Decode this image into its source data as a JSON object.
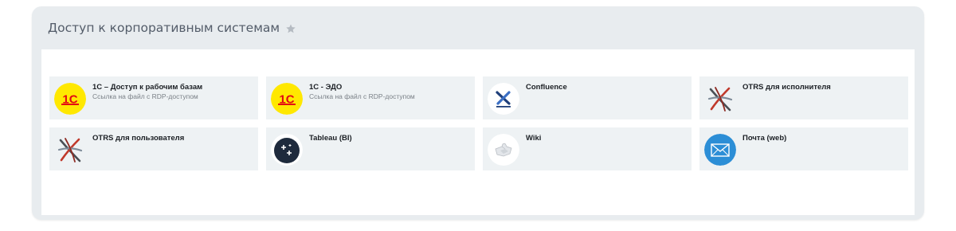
{
  "section": {
    "title": "Доступ к корпоративным системам",
    "star_icon": "star-icon"
  },
  "colors": {
    "panel_bg": "#e8ecef",
    "tile_bg": "#eef2f4",
    "onec_yellow": "#ffe800",
    "onec_red": "#e30613",
    "tableau_dark": "#1e2a3c",
    "mail_blue": "#2c8ed6"
  },
  "tiles": [
    {
      "name": "1С – Доступ к рабочим базам",
      "desc": "Ссылка на файл с RDP-доступом",
      "icon": "onec-logo-icon"
    },
    {
      "name": "1С - ЭДО",
      "desc": "Ссылка на файл с RDP-доступом",
      "icon": "onec-logo-icon"
    },
    {
      "name": "Confluence",
      "desc": "",
      "icon": "confluence-logo-icon"
    },
    {
      "name": "OTRS для исполнителя",
      "desc": "",
      "icon": "otrs-logo-icon"
    },
    {
      "name": "OTRS для пользователя",
      "desc": "",
      "icon": "otrs-logo-icon"
    },
    {
      "name": "Tableau (BI)",
      "desc": "",
      "icon": "tableau-logo-icon"
    },
    {
      "name": "Wiki",
      "desc": "",
      "icon": "wiki-puzzle-icon"
    },
    {
      "name": "Почта (web)",
      "desc": "",
      "icon": "mail-envelope-icon"
    }
  ]
}
